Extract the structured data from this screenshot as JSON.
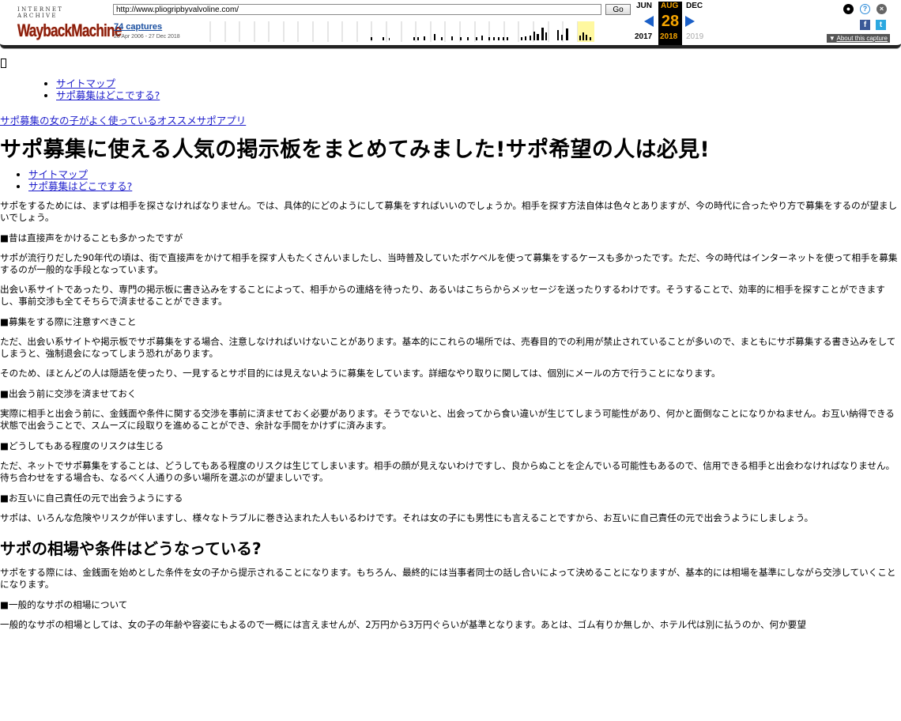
{
  "wayback": {
    "logo_top": "INTERNET ARCHIVE",
    "logo_main": "WaybackMachine",
    "url": "http://www.pliogripbyvalvoline.com/",
    "go_label": "Go",
    "captures_label": "74 captures",
    "date_range": "20 Apr 2006 - 27 Dec 2018",
    "prev_month": "JUN",
    "cur_month": "AUG",
    "next_month": "DEC",
    "cur_day": "28",
    "prev_year": "2017",
    "cur_year": "2018",
    "next_year": "2019",
    "about_label": "About this capture"
  },
  "nav_top": {
    "items": [
      {
        "label": "サイトマップ"
      },
      {
        "label": "サポ募集はどこでする?"
      }
    ]
  },
  "site_link": "サポ募集の女の子がよく使っているオススメサポアプリ",
  "title": "サポ募集に使える人気の掲示板をまとめてみました!サポ希望の人は必見!",
  "nav_mid": {
    "items": [
      {
        "label": "サイトマップ"
      },
      {
        "label": "サポ募集はどこでする?"
      }
    ]
  },
  "content": {
    "p1": "サポをするためには、まずは相手を探さなければなりません。では、具体的にどのようにして募集をすればいいのでしょうか。相手を探す方法自体は色々とありますが、今の時代に合ったやり方で募集をするのが望ましいでしょう。",
    "s1": "■昔は直接声をかけることも多かったですが",
    "p2": "サポが流行りだした90年代の頃は、街で直接声をかけて相手を探す人もたくさんいましたし、当時普及していたポケベルを使って募集をするケースも多かったです。ただ、今の時代はインターネットを使って相手を募集するのが一般的な手段となっています。",
    "p3": "出会い系サイトであったり、専門の掲示板に書き込みをすることによって、相手からの連絡を待ったり、あるいはこちらからメッセージを送ったりするわけです。そうすることで、効率的に相手を探すことができますし、事前交渉も全てそちらで済ませることができます。",
    "s2": "■募集をする際に注意すべきこと",
    "p4": "ただ、出会い系サイトや掲示板でサポ募集をする場合、注意しなければいけないことがあります。基本的にこれらの場所では、売春目的での利用が禁止されていることが多いので、まともにサポ募集する書き込みをしてしまうと、強制退会になってしまう恐れがあります。",
    "p5": "そのため、ほとんどの人は隠語を使ったり、一見するとサポ目的には見えないように募集をしています。詳細なやり取りに関しては、個別にメールの方で行うことになります。",
    "s3": "■出会う前に交渉を済ませておく",
    "p6": "実際に相手と出会う前に、金銭面や条件に関する交渉を事前に済ませておく必要があります。そうでないと、出会ってから食い違いが生じてしまう可能性があり、何かと面倒なことになりかねません。お互い納得できる状態で出会うことで、スムーズに段取りを進めることができ、余計な手間をかけずに済みます。",
    "s4": "■どうしてもある程度のリスクは生じる",
    "p7": "ただ、ネットでサポ募集をすることは、どうしてもある程度のリスクは生じてしまいます。相手の顔が見えないわけですし、良からぬことを企んでいる可能性もあるので、信用できる相手と出会わなければなりません。待ち合わせをする場合も、なるべく人通りの多い場所を選ぶのが望ましいです。",
    "s5": "■お互いに自己責任の元で出会うようにする",
    "p8": "サポは、いろんな危険やリスクが伴いますし、様々なトラブルに巻き込まれた人もいるわけです。それは女の子にも男性にも言えることですから、お互いに自己責任の元で出会うようにしましょう。",
    "h2": "サポの相場や条件はどうなっている?",
    "p9": "サポをする際には、金銭面を始めとした条件を女の子から提示されることになります。もちろん、最終的には当事者同士の話し合いによって決めることになりますが、基本的には相場を基準にしながら交渉していくことになります。",
    "s6": "■一般的なサポの相場について",
    "p10": "一般的なサポの相場としては、女の子の年齢や容姿にもよるので一概には言えませんが、2万円から3万円ぐらいが基準となります。あとは、ゴム有りか無しか、ホテル代は別に払うのか、何か要望"
  }
}
